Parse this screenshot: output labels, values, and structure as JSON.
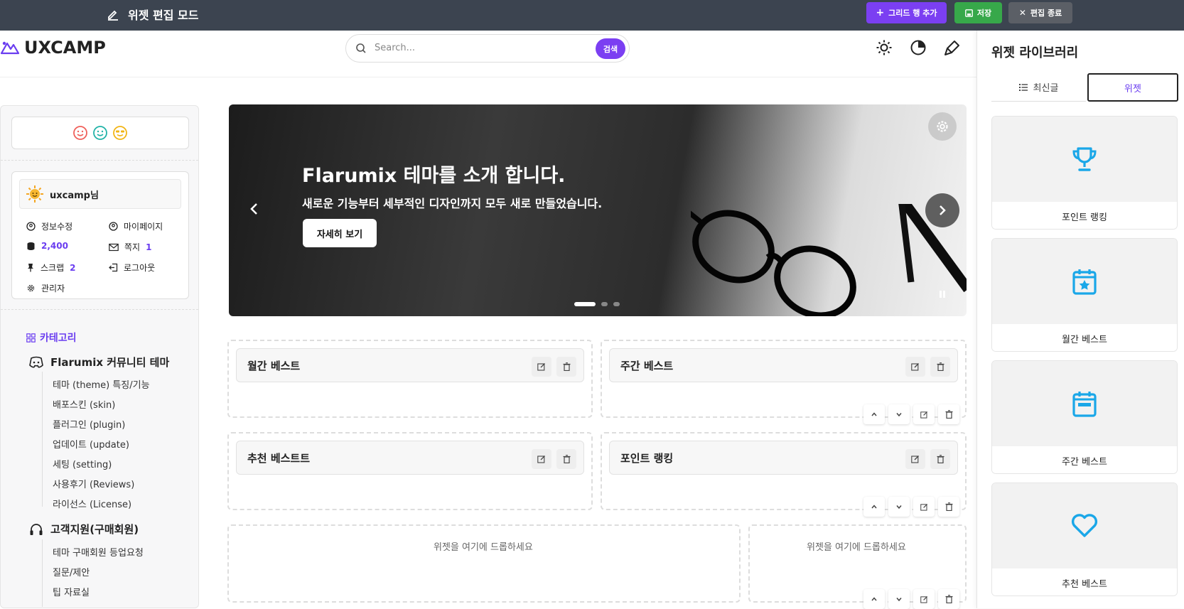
{
  "topbar": {
    "title": "위젯 편집 모드",
    "add_row": "그리드 행 추가",
    "save": "저장",
    "exit": "편집 종료"
  },
  "header": {
    "logo": "UXCAMP",
    "search": {
      "placeholder": "Search...",
      "button": "검색"
    }
  },
  "sidebar": {
    "user": {
      "name": "uxcamp님"
    },
    "links": {
      "edit_info": "정보수정",
      "mypage": "마이페이지",
      "points": "2,400",
      "messages": "쪽지",
      "messages_count": "1",
      "scrap": "스크랩",
      "scrap_count": "2",
      "logout": "로그아웃",
      "admin": "관리자"
    },
    "category_title": "카테고리",
    "groups": [
      {
        "title": "Flarumix 커뮤니티 테마",
        "items": [
          "테마 (theme) 특징/기능",
          "배포스킨 (skin)",
          "플러그인 (plugin)",
          "업데이트 (update)",
          "세팅 (setting)",
          "사용후기 (Reviews)",
          "라이선스 (License)"
        ]
      },
      {
        "title": "고객지원(구매회원)",
        "items": [
          "테마 구매회원 등업요청",
          "질문/제안",
          "팁 자료실"
        ]
      }
    ]
  },
  "hero": {
    "title": "Flarumix 테마를 소개 합니다.",
    "subtitle": "새로운 기능부터 세부적인 디자인까지 모두 새로 만들었습니다.",
    "button": "자세히 보기"
  },
  "widgets": {
    "monthly": "월간 베스트",
    "weekly": "주간 베스트",
    "recommend": "추천 베스트트",
    "points": "포인트 랭킹",
    "drop_here": "위젯을 여기에 드롭하세요"
  },
  "library": {
    "title": "위젯 라이브러리",
    "tab_recent": "최신글",
    "tab_widget": "위젯",
    "items": [
      "포인트 랭킹",
      "월간 베스트",
      "주간 베스트",
      "추천 베스트"
    ]
  },
  "colors": {
    "accent": "#7b3ff2",
    "save": "#37a84a",
    "icon": "#1aa7e8"
  }
}
